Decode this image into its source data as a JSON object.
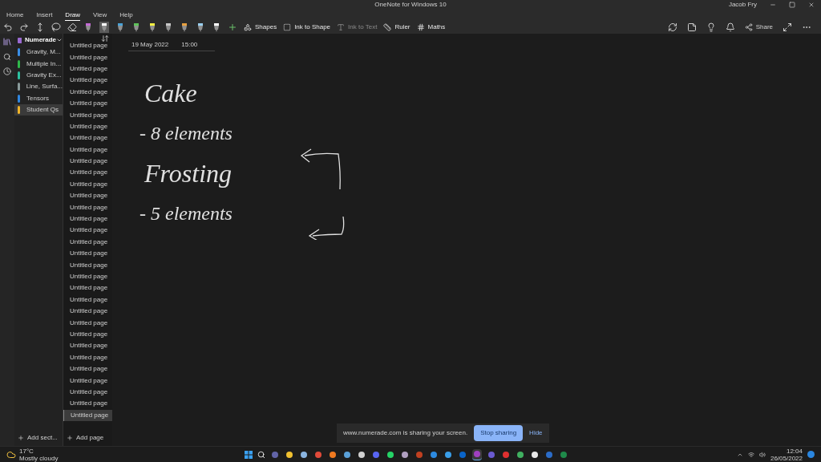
{
  "window": {
    "title": "OneNote for Windows 10",
    "user": "Jacob Fry"
  },
  "menu_tabs": [
    {
      "label": "Home",
      "selected": false
    },
    {
      "label": "Insert",
      "selected": false
    },
    {
      "label": "Draw",
      "selected": true
    },
    {
      "label": "View",
      "selected": false
    },
    {
      "label": "Help",
      "selected": false
    }
  ],
  "pens": [
    {
      "color": "#c46ad6",
      "selected": false
    },
    {
      "color": "#ffffff",
      "selected": true
    },
    {
      "color": "#4aa3d8",
      "selected": false
    },
    {
      "color": "#5fc45a",
      "selected": false
    },
    {
      "color": "#f4f042",
      "selected": false
    },
    {
      "color": "#c8c8c8",
      "selected": false
    },
    {
      "color": "#e8a040",
      "selected": false
    },
    {
      "color": "#9ad0f0",
      "selected": false
    },
    {
      "color": "#ffffff",
      "selected": false
    }
  ],
  "toolbar": [
    {
      "label": "Shapes",
      "disabled": false
    },
    {
      "label": "Ink to Shape",
      "disabled": false
    },
    {
      "label": "Ink to Text",
      "disabled": true
    },
    {
      "label": "Ruler",
      "disabled": false
    },
    {
      "label": "Maths",
      "disabled": false
    }
  ],
  "share": "Share",
  "notebook": "Numerade",
  "sections": [
    {
      "label": "Gravity, M...",
      "color": "#3a8ee6",
      "selected": false
    },
    {
      "label": "Multiple In...",
      "color": "#2fb84a",
      "selected": false
    },
    {
      "label": "Gravity Ex...",
      "color": "#2cc0a0",
      "selected": false
    },
    {
      "label": "Line, Surfa...",
      "color": "#8a9a9a",
      "selected": false
    },
    {
      "label": "Tensors",
      "color": "#2f86e0",
      "selected": false
    },
    {
      "label": "Student Qs",
      "color": "#f0b429",
      "selected": true
    }
  ],
  "pages": [
    {
      "label": "Untitled page",
      "selected": false
    },
    {
      "label": "Untitled page",
      "selected": false
    },
    {
      "label": "Untitled page",
      "selected": false
    },
    {
      "label": "Untitled page",
      "selected": false
    },
    {
      "label": "Untitled page",
      "selected": false
    },
    {
      "label": "Untitled page",
      "selected": false
    },
    {
      "label": "Untitled page",
      "selected": false
    },
    {
      "label": "Untitled page",
      "selected": false
    },
    {
      "label": "Untitled page",
      "selected": false
    },
    {
      "label": "Untitled page",
      "selected": false
    },
    {
      "label": "Untitled page",
      "selected": false
    },
    {
      "label": "Untitled page",
      "selected": false
    },
    {
      "label": "Untitled page",
      "selected": false
    },
    {
      "label": "Untitled page",
      "selected": false
    },
    {
      "label": "Untitled page",
      "selected": false
    },
    {
      "label": "Untitled page",
      "selected": false
    },
    {
      "label": "Untitled page",
      "selected": false
    },
    {
      "label": "Untitled page",
      "selected": false
    },
    {
      "label": "Untitled page",
      "selected": false
    },
    {
      "label": "Untitled page",
      "selected": false
    },
    {
      "label": "Untitled page",
      "selected": false
    },
    {
      "label": "Untitled page",
      "selected": false
    },
    {
      "label": "Untitled page",
      "selected": false
    },
    {
      "label": "Untitled page",
      "selected": false
    },
    {
      "label": "Untitled page",
      "selected": false
    },
    {
      "label": "Untitled page",
      "selected": false
    },
    {
      "label": "Untitled page",
      "selected": false
    },
    {
      "label": "Untitled page",
      "selected": false
    },
    {
      "label": "Untitled page",
      "selected": false
    },
    {
      "label": "Untitled page",
      "selected": false
    },
    {
      "label": "Untitled page",
      "selected": false
    },
    {
      "label": "Untitled page",
      "selected": false
    },
    {
      "label": "Untitled page",
      "selected": true
    }
  ],
  "add_section": "Add sect...",
  "add_page": "Add page",
  "note": {
    "date": "19 May 2022",
    "time": "15:00",
    "ink": [
      {
        "text": "Cake",
        "kind": "heading"
      },
      {
        "text": "- 8 elements",
        "kind": "item"
      },
      {
        "text": "Frosting",
        "kind": "heading"
      },
      {
        "text": "- 5 elements",
        "kind": "item"
      }
    ]
  },
  "share_banner": {
    "message": "www.numerade.com is sharing your screen.",
    "stop": "Stop sharing",
    "hide": "Hide"
  },
  "taskbar": {
    "temperature": "17°C",
    "weather": "Mostly cloudy",
    "apps": [
      {
        "color": "#6264a7",
        "selected": false
      },
      {
        "color": "#f0c030",
        "selected": false
      },
      {
        "color": "#8ab4e0",
        "selected": false
      },
      {
        "color": "#e04a3a",
        "selected": false
      },
      {
        "color": "#f07a20",
        "selected": false
      },
      {
        "color": "#5aa0d8",
        "selected": false
      },
      {
        "color": "#d0d0d0",
        "selected": false
      },
      {
        "color": "#5865f2",
        "selected": false
      },
      {
        "color": "#25d366",
        "selected": false
      },
      {
        "color": "#b0a0c0",
        "selected": false
      },
      {
        "color": "#c04020",
        "selected": false
      },
      {
        "color": "#2d8ae0",
        "selected": false
      },
      {
        "color": "#3a9ee8",
        "selected": false
      },
      {
        "color": "#0a64c8",
        "selected": false
      },
      {
        "color": "#a040c0",
        "selected": true
      },
      {
        "color": "#6a5ad0",
        "selected": false
      },
      {
        "color": "#e03030",
        "selected": false
      },
      {
        "color": "#40b060",
        "selected": false
      },
      {
        "color": "#e8e8e8",
        "selected": false
      },
      {
        "color": "#2b6cc8",
        "selected": false
      },
      {
        "color": "#1f8a4a",
        "selected": false
      }
    ],
    "time": "12:04",
    "date": "26/05/2022"
  }
}
